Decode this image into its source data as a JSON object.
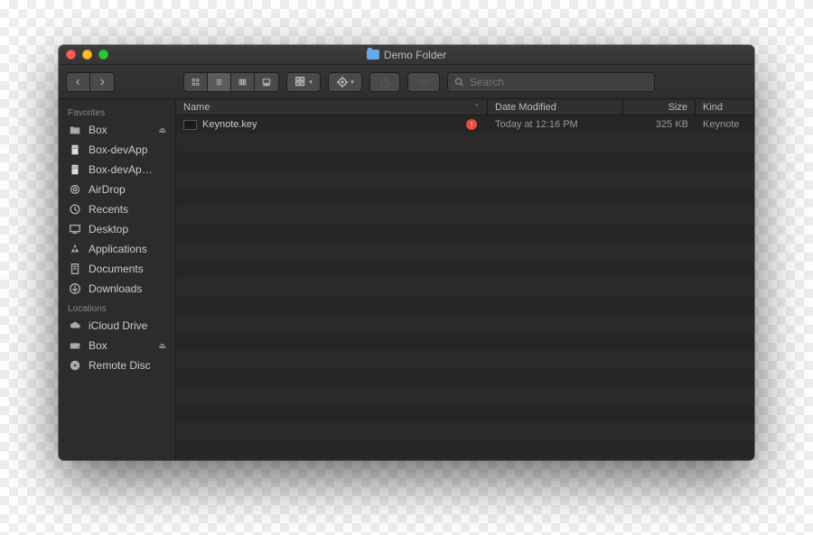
{
  "window": {
    "title": "Demo Folder"
  },
  "toolbar": {
    "search_placeholder": "Search"
  },
  "sidebar": {
    "sections": [
      {
        "header": "Favorites",
        "items": [
          {
            "icon": "folder",
            "label": "Box",
            "eject": true
          },
          {
            "icon": "doc",
            "label": "Box-devApp"
          },
          {
            "icon": "doc",
            "label": "Box-devAp…"
          },
          {
            "icon": "airdrop",
            "label": "AirDrop"
          },
          {
            "icon": "recents",
            "label": "Recents"
          },
          {
            "icon": "desktop",
            "label": "Desktop"
          },
          {
            "icon": "apps",
            "label": "Applications"
          },
          {
            "icon": "docs",
            "label": "Documents"
          },
          {
            "icon": "downloads",
            "label": "Downloads"
          }
        ]
      },
      {
        "header": "Locations",
        "items": [
          {
            "icon": "cloud",
            "label": "iCloud Drive"
          },
          {
            "icon": "disk",
            "label": "Box",
            "eject": true
          },
          {
            "icon": "disc",
            "label": "Remote Disc"
          }
        ]
      }
    ]
  },
  "columns": {
    "name": "Name",
    "date": "Date Modified",
    "size": "Size",
    "kind": "Kind"
  },
  "files": [
    {
      "name": "Keynote.key",
      "status": "error",
      "date": "Today at 12:16 PM",
      "size": "325 KB",
      "kind": "Keynote"
    }
  ]
}
